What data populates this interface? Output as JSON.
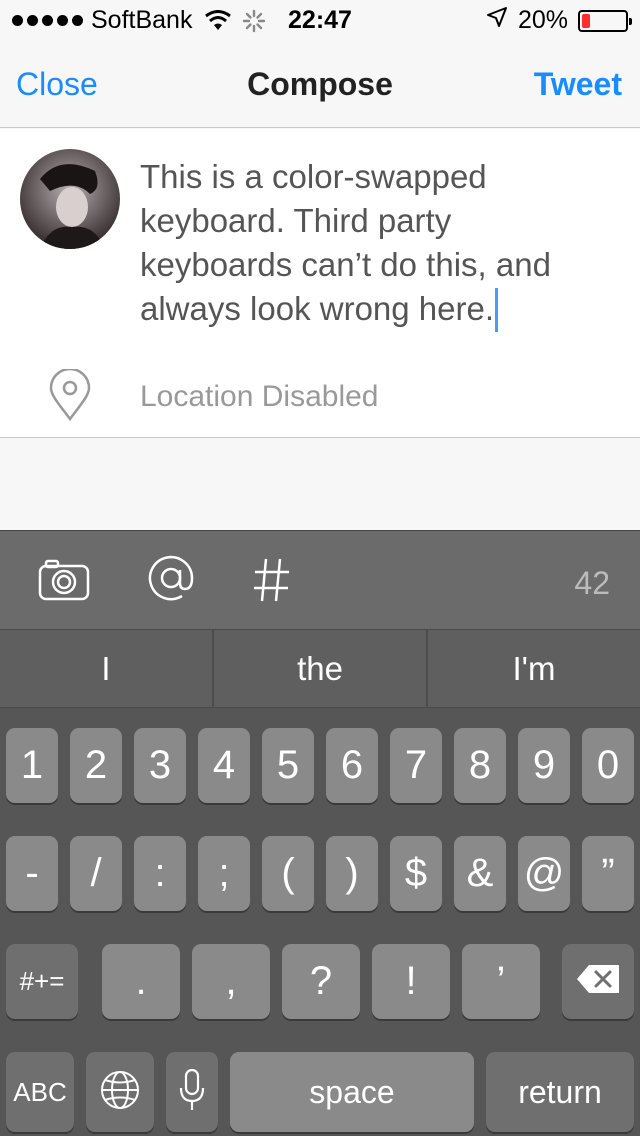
{
  "status_bar": {
    "carrier": "SoftBank",
    "time": "22:47",
    "battery": "20%",
    "battery_level": 0.2,
    "battery_color": "#ff2d2d"
  },
  "nav": {
    "close_label": "Close",
    "title": "Compose",
    "tweet_label": "Tweet",
    "accent_color": "#1a8cff"
  },
  "compose": {
    "text": "This is a color-swapped keyboard. Third party keyboards can’t do this, and always look wrong here.",
    "location_label": "Location Disabled"
  },
  "accessory": {
    "char_count": "42"
  },
  "suggestions": [
    "I",
    "the",
    "I'm"
  ],
  "keyboard": {
    "row1": [
      "1",
      "2",
      "3",
      "4",
      "5",
      "6",
      "7",
      "8",
      "9",
      "0"
    ],
    "row2": [
      "-",
      "/",
      ":",
      ";",
      "(",
      ")",
      "$",
      "&",
      "@",
      "”"
    ],
    "row3": {
      "shift": "#+=",
      "keys": [
        ".",
        ",",
        "?",
        "!",
        "’"
      ]
    },
    "row4": {
      "abc": "ABC",
      "space": "space",
      "return": "return"
    }
  }
}
